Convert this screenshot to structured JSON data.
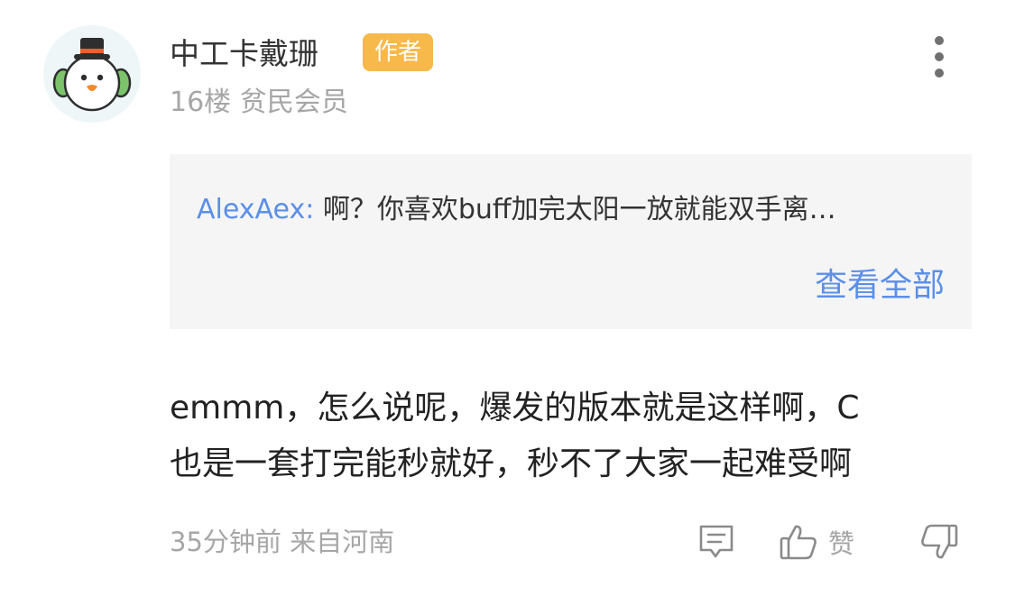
{
  "user": {
    "name": "中工卡戴珊",
    "badge": "作者",
    "floor": "16楼",
    "level": "贫民会员"
  },
  "quote": {
    "author": "AlexAex:",
    "text": "啊？你喜欢buff加完太阳一放就能双手离…",
    "view_all": "查看全部"
  },
  "comment": {
    "lines": [
      "emmm，怎么说呢，爆发的版本就是这样啊，C",
      "也是一套打完能秒就好，秒不了大家一起难受啊"
    ]
  },
  "footer": {
    "time_location": "35分钟前 来自河南",
    "like_label": "赞"
  },
  "icons": {
    "avatar": "snowman-avatar",
    "more": "more-vertical-icon",
    "reply": "comment-icon",
    "like": "thumbs-up-icon",
    "dislike": "thumbs-down-icon"
  },
  "colors": {
    "accent_link": "#5b8fe8",
    "badge": "#f7b94a",
    "muted_text": "#a6a6a6",
    "quote_bg": "#f5f5f5"
  }
}
